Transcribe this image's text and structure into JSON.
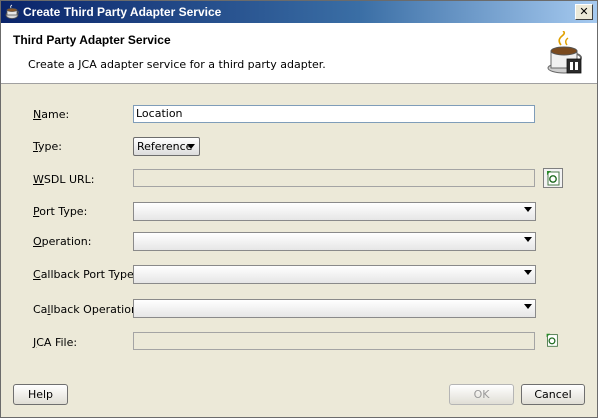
{
  "window": {
    "title": "Create Third Party Adapter Service",
    "close_label": "✕"
  },
  "header": {
    "title": "Third Party Adapter Service",
    "description": "Create a JCA adapter service for a third party adapter."
  },
  "form": {
    "name": {
      "label_first": "N",
      "label_rest": "ame:",
      "value": "Location"
    },
    "type": {
      "label_first": "T",
      "label_rest": "ype:",
      "value": "Reference"
    },
    "wsdl_url": {
      "label_first": "W",
      "label_rest": "SDL URL:",
      "value": ""
    },
    "port_type": {
      "label_first": "P",
      "label_rest": "ort Type:",
      "value": ""
    },
    "operation": {
      "label_first": "O",
      "label_rest": "peration:",
      "value": ""
    },
    "callback_port_type": {
      "label_first": "C",
      "label_rest": "allback Port Type:",
      "value": ""
    },
    "callback_operation": {
      "label_pre": "Ca",
      "label_first": "l",
      "label_rest": "lback Operation:",
      "value": ""
    },
    "jca_file": {
      "label_first": "J",
      "label_rest": "CA File:",
      "value": ""
    }
  },
  "buttons": {
    "help": "Help",
    "ok": "OK",
    "cancel": "Cancel"
  }
}
